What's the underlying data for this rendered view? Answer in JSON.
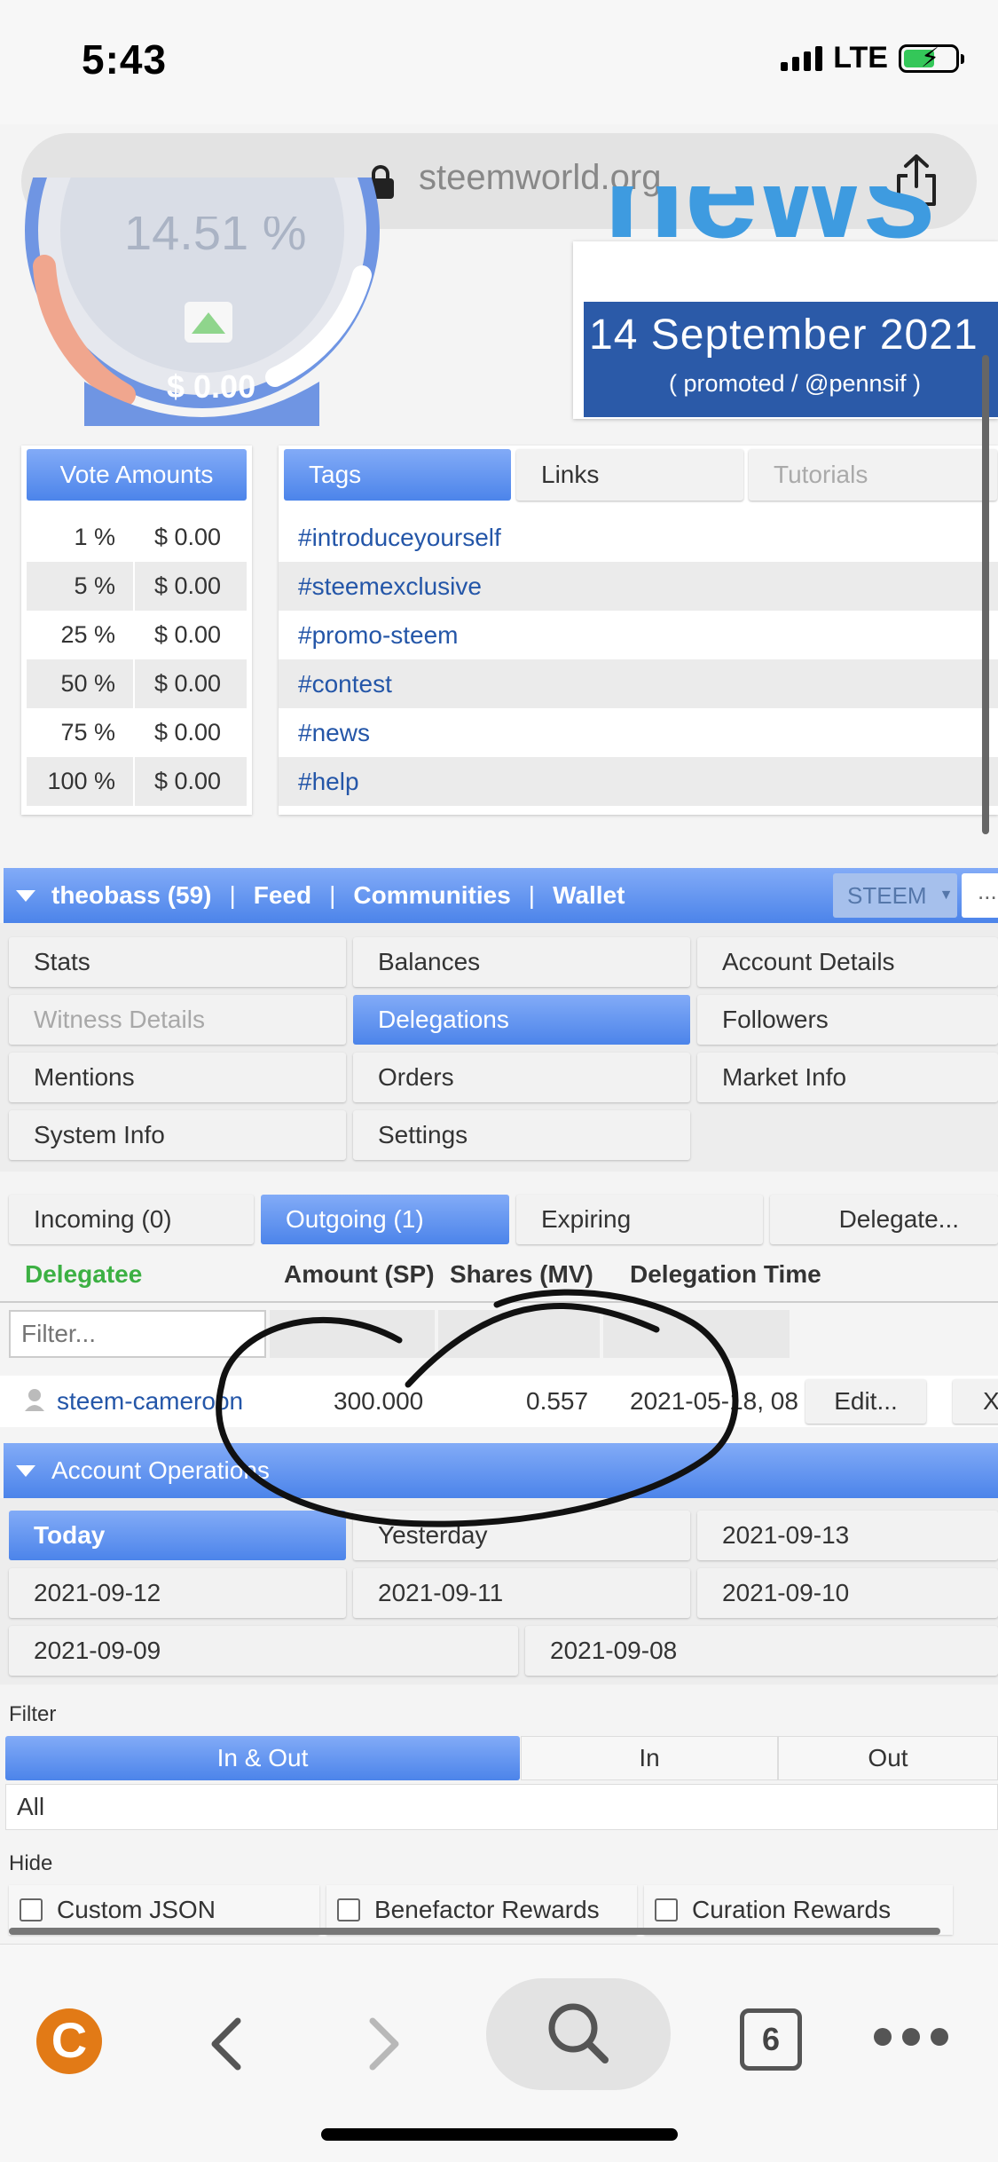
{
  "status": {
    "time": "5:43",
    "network": "LTE"
  },
  "browser": {
    "url": "steemworld.org"
  },
  "gauge": {
    "percent_partial": "14.51 %",
    "value": "$ 0.00"
  },
  "banner": {
    "news": "news",
    "date": "14 September 2021",
    "sub": "( promoted / @pennsif )"
  },
  "vote_amounts": {
    "header": "Vote Amounts",
    "rows": [
      {
        "pct": "1 %",
        "amt": "$ 0.00"
      },
      {
        "pct": "5 %",
        "amt": "$ 0.00"
      },
      {
        "pct": "25 %",
        "amt": "$ 0.00"
      },
      {
        "pct": "50 %",
        "amt": "$ 0.00"
      },
      {
        "pct": "75 %",
        "amt": "$ 0.00"
      },
      {
        "pct": "100 %",
        "amt": "$ 0.00"
      }
    ]
  },
  "tags_panel": {
    "tabs": [
      "Tags",
      "Links",
      "Tutorials"
    ],
    "tags": [
      "#introduceyourself",
      "#steemexclusive",
      "#promo-steem",
      "#contest",
      "#news",
      "#help"
    ]
  },
  "user_nav": {
    "user": "theobass (59)",
    "links": [
      "Feed",
      "Communities",
      "Wallet"
    ],
    "select": "STEEM",
    "more": "..."
  },
  "menu": {
    "stats": "Stats",
    "balances": "Balances",
    "account_details": "Account Details",
    "witness_details": "Witness Details",
    "delegations": "Delegations",
    "followers": "Followers",
    "mentions": "Mentions",
    "orders": "Orders",
    "market_info": "Market Info",
    "system_info": "System Info",
    "settings": "Settings"
  },
  "delegation_tabs": {
    "incoming": "Incoming (0)",
    "outgoing": "Outgoing (1)",
    "expiring": "Expiring",
    "delegate": "Delegate..."
  },
  "table": {
    "headers": {
      "delegatee": "Delegatee",
      "amount": "Amount (SP)",
      "shares": "Shares (MV)",
      "time": "Delegation Time"
    },
    "filter_placeholder": "Filter...",
    "row": {
      "delegatee": "steem-cameroon",
      "amount": "300.000",
      "shares": "0.557",
      "time": "2021-05-18, 08",
      "edit": "Edit...",
      "remove": "X"
    }
  },
  "account_ops": {
    "title": "Account Operations",
    "dates": [
      "Today",
      "Yesterday",
      "2021-09-13",
      "2021-09-12",
      "2021-09-11",
      "2021-09-10",
      "2021-09-09",
      "2021-09-08"
    ]
  },
  "filter": {
    "label": "Filter",
    "options": [
      "In & Out",
      "In",
      "Out"
    ],
    "select_value": "All"
  },
  "hide": {
    "label": "Hide",
    "options": [
      "Custom JSON",
      "Benefactor Rewards",
      "Curation Rewards"
    ]
  },
  "toolbar": {
    "tab_count": "6"
  },
  "colors": {
    "accent_blue": "#4c84ea",
    "link_blue": "#2456a8",
    "delegatee_green": "#3cb043",
    "banner_blue": "#2b5aa8",
    "logo_orange": "#e27a16"
  }
}
